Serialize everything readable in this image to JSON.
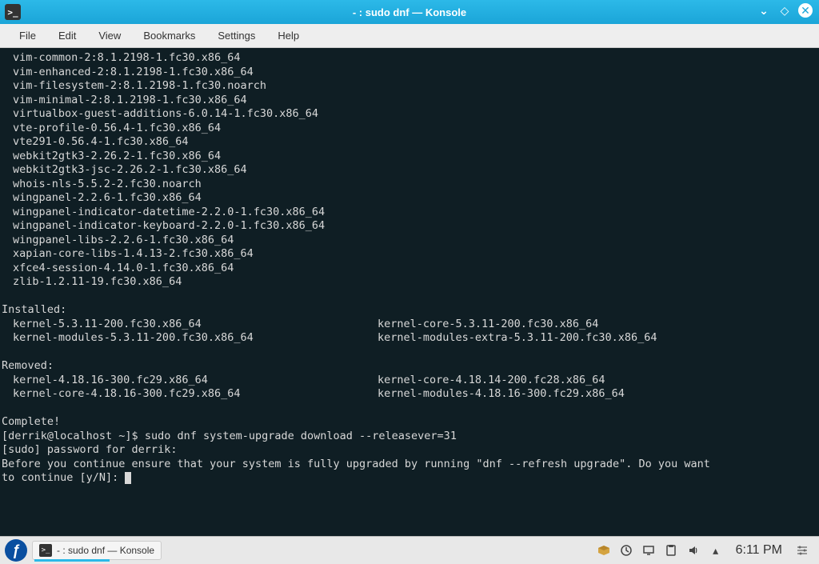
{
  "window": {
    "title": "- : sudo dnf — Konsole"
  },
  "menubar": {
    "items": [
      "File",
      "Edit",
      "View",
      "Bookmarks",
      "Settings",
      "Help"
    ]
  },
  "terminal": {
    "packages": [
      "vim-common-2:8.1.2198-1.fc30.x86_64",
      "vim-enhanced-2:8.1.2198-1.fc30.x86_64",
      "vim-filesystem-2:8.1.2198-1.fc30.noarch",
      "vim-minimal-2:8.1.2198-1.fc30.x86_64",
      "virtualbox-guest-additions-6.0.14-1.fc30.x86_64",
      "vte-profile-0.56.4-1.fc30.x86_64",
      "vte291-0.56.4-1.fc30.x86_64",
      "webkit2gtk3-2.26.2-1.fc30.x86_64",
      "webkit2gtk3-jsc-2.26.2-1.fc30.x86_64",
      "whois-nls-5.5.2-2.fc30.noarch",
      "wingpanel-2.2.6-1.fc30.x86_64",
      "wingpanel-indicator-datetime-2.2.0-1.fc30.x86_64",
      "wingpanel-indicator-keyboard-2.2.0-1.fc30.x86_64",
      "wingpanel-libs-2.2.6-1.fc30.x86_64",
      "xapian-core-libs-1.4.13-2.fc30.x86_64",
      "xfce4-session-4.14.0-1.fc30.x86_64",
      "zlib-1.2.11-19.fc30.x86_64"
    ],
    "installed_header": "Installed:",
    "installed": [
      {
        "left": "kernel-5.3.11-200.fc30.x86_64",
        "right": "kernel-core-5.3.11-200.fc30.x86_64"
      },
      {
        "left": "kernel-modules-5.3.11-200.fc30.x86_64",
        "right": "kernel-modules-extra-5.3.11-200.fc30.x86_64"
      }
    ],
    "removed_header": "Removed:",
    "removed": [
      {
        "left": "kernel-4.18.16-300.fc29.x86_64",
        "right": "kernel-core-4.18.14-200.fc28.x86_64"
      },
      {
        "left": "kernel-core-4.18.16-300.fc29.x86_64",
        "right": "kernel-modules-4.18.16-300.fc29.x86_64"
      }
    ],
    "complete": "Complete!",
    "prompt": "[derrik@localhost ~]$ ",
    "command": "sudo dnf system-upgrade download --releasever=31",
    "sudo_line": "[sudo] password for derrik:",
    "confirm_line": "Before you continue ensure that your system is fully upgraded by running \"dnf --refresh upgrade\". Do you want\nto continue [y/N]: "
  },
  "taskbar": {
    "task_label": "- : sudo dnf — Konsole",
    "clock": "6:11 PM"
  }
}
